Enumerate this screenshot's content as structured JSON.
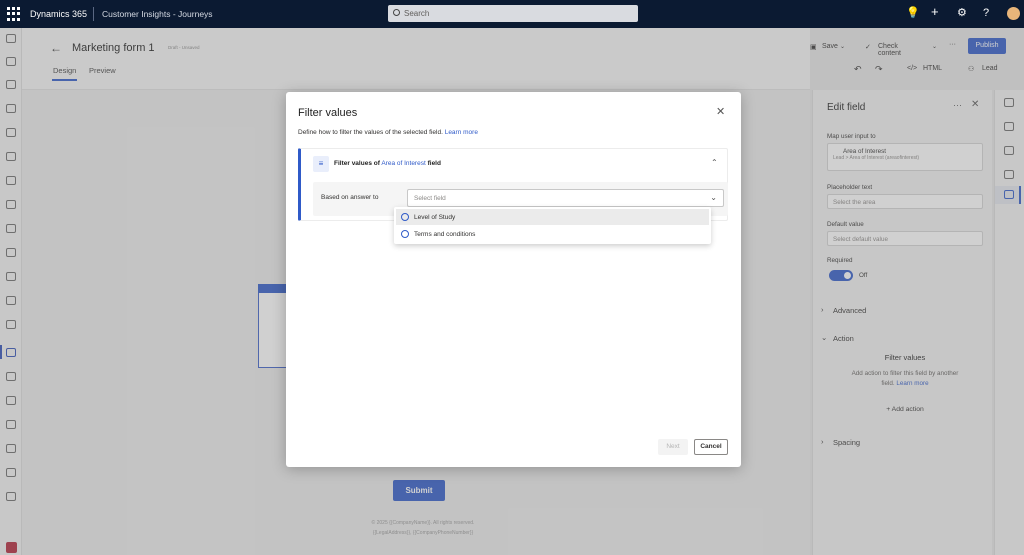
{
  "topbar": {
    "brand": "Dynamics 365",
    "app_name": "Customer Insights - Journeys",
    "search_placeholder": "Search"
  },
  "form": {
    "title": "Marketing form 1",
    "status": "Draft - Unsaved",
    "tabs": [
      "Design",
      "Preview"
    ],
    "commands": {
      "save": "Save",
      "check_content": "Check content",
      "more": "···",
      "publish": "Publish",
      "html": "HTML",
      "lead": "Lead"
    },
    "submit": "Submit",
    "footer_line1": "© 2025 {{CompanyName}}. All rights reserved.",
    "footer_line2": "{{LegalAddress}}, {{CompanyPhoneNumber}}"
  },
  "edit_field": {
    "title": "Edit field",
    "map_label": "Map user input to",
    "map_value": "Area of Interest",
    "map_sub": "Lead > Area of Interest (areaofinterest)",
    "placeholder_label": "Placeholder text",
    "placeholder_value": "Select the area",
    "default_label": "Default value",
    "default_placeholder": "Select default value",
    "required_label": "Required",
    "required_state": "Off",
    "sections": {
      "advanced": "Advanced",
      "action": "Action",
      "spacing": "Spacing"
    },
    "filter_title": "Filter values",
    "filter_desc1": "Add action to filter this field by another",
    "filter_desc2": "field.",
    "learn_more": "Learn more",
    "add_action": "Add action"
  },
  "dialog": {
    "title": "Filter values",
    "description": "Define how to filter the values of the selected field.",
    "learn_more": "Learn more",
    "card_title_prefix": "Filter values of",
    "card_field": "Area of Interest",
    "card_title_suffix": "field",
    "based_on_label": "Based on answer to",
    "select_placeholder": "Select field",
    "options": [
      "Level of Study",
      "Terms and conditions"
    ],
    "next": "Next",
    "cancel": "Cancel"
  }
}
